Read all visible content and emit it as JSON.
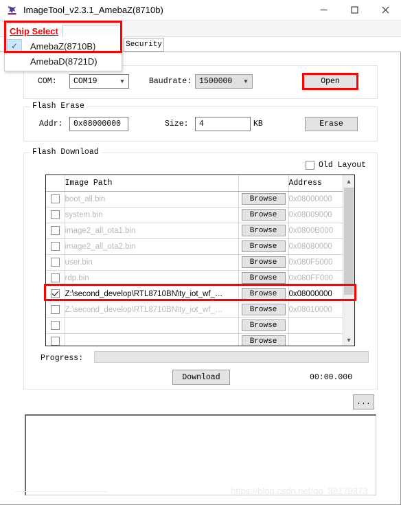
{
  "window": {
    "title": "ImageTool_v2.3.1_AmebaZ(8710b)",
    "icon": "app-logo-icon",
    "controls": {
      "minimize": "—",
      "maximize": "☐",
      "close": "✕"
    }
  },
  "menu": {
    "chip_select": {
      "label": "Chip Select",
      "highlight_color": "#ff0000",
      "items": [
        {
          "label": "AmebaZ(8710B)",
          "checked": true
        },
        {
          "label": "AmebaD(8721D)",
          "checked": false
        }
      ]
    }
  },
  "tabs": [
    {
      "label": "Security",
      "active": false
    }
  ],
  "connection": {
    "com_label": "COM:",
    "com_value": "COM19",
    "baudrate_label": "Baudrate:",
    "baudrate_value": "1500000",
    "open_button": "Open",
    "open_button_highlight": "#ff0000"
  },
  "flash_erase": {
    "legend": "Flash Erase",
    "addr_label": "Addr:",
    "addr_value": "0x08000000",
    "size_label": "Size:",
    "size_value": "4",
    "size_unit": "KB",
    "erase_button": "Erase"
  },
  "flash_download": {
    "legend": "Flash Download",
    "old_layout_label": "Old Layout",
    "old_layout_checked": false,
    "columns": [
      "",
      "Image Path",
      "",
      "Address"
    ],
    "browse_label": "Browse",
    "rows": [
      {
        "checked": false,
        "path": "boot_all.bin",
        "address": "0x08000000",
        "active": false
      },
      {
        "checked": false,
        "path": "system.bin",
        "address": "0x08009000",
        "active": false
      },
      {
        "checked": false,
        "path": "image2_all_ota1.bin",
        "address": "0x0800B000",
        "active": false
      },
      {
        "checked": false,
        "path": "image2_all_ota2.bin",
        "address": "0x08080000",
        "active": false
      },
      {
        "checked": false,
        "path": "user.bin",
        "address": "0x080F5000",
        "active": false
      },
      {
        "checked": false,
        "path": "rdp.bin",
        "address": "0x080FF000",
        "active": false
      },
      {
        "checked": true,
        "path": "Z:\\second_develop\\RTL8710BN\\ty_iot_wf_…",
        "address": "0x08000000",
        "active": true
      },
      {
        "checked": false,
        "path": "Z:\\second_develop\\RTL8710BN\\ty_iot_wf_…",
        "address": "0x08010000",
        "active": false
      },
      {
        "checked": false,
        "path": "",
        "address": "",
        "active": false
      },
      {
        "checked": false,
        "path": "",
        "address": "",
        "active": false
      }
    ],
    "highlight_row_index": 6,
    "highlight_color": "#ff0000",
    "progress_label": "Progress:",
    "progress_percent": 0,
    "download_button": "Download",
    "elapsed_time": "00:00.000"
  },
  "footer": {
    "more_button": "...",
    "log_text": ""
  },
  "watermark": "https://blog.csdn.net/qq_38179373"
}
